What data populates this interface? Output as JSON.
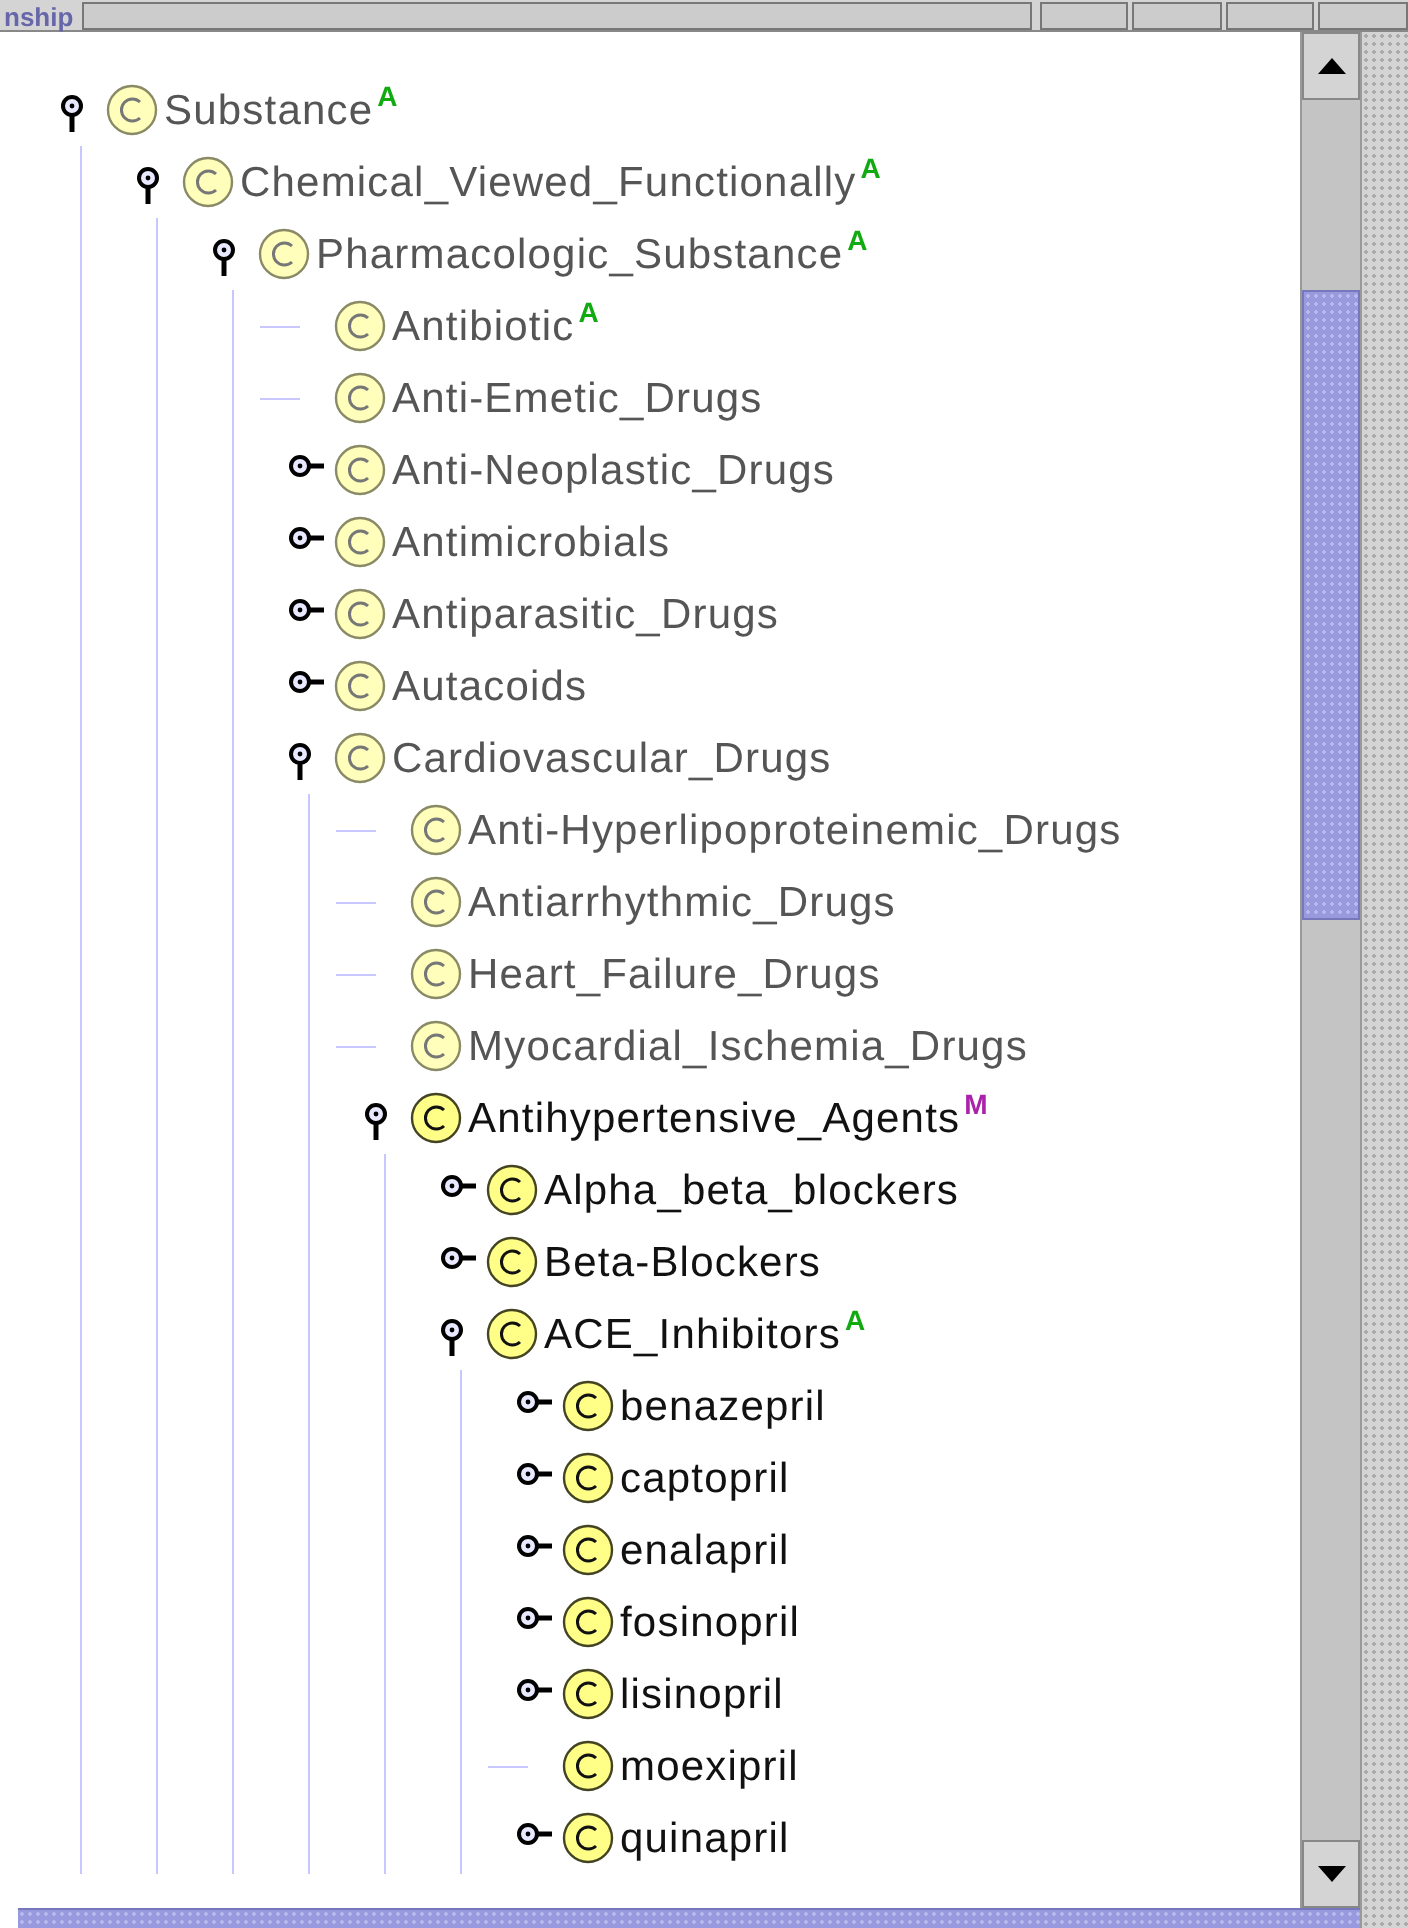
{
  "header": {
    "label": "nship"
  },
  "tree": [
    {
      "name": "Substance",
      "expanded": true,
      "greyed": true,
      "badge": "A",
      "children": [
        {
          "name": "Chemical_Viewed_Functionally",
          "expanded": true,
          "greyed": true,
          "badge": "A",
          "children": [
            {
              "name": "Pharmacologic_Substance",
              "expanded": true,
              "greyed": true,
              "badge": "A",
              "children": [
                {
                  "name": "Antibiotic",
                  "greyed": true,
                  "badge": "A"
                },
                {
                  "name": "Anti-Emetic_Drugs",
                  "greyed": true
                },
                {
                  "name": "Anti-Neoplastic_Drugs",
                  "expanded": false,
                  "greyed": true
                },
                {
                  "name": "Antimicrobials",
                  "expanded": false,
                  "greyed": true
                },
                {
                  "name": "Antiparasitic_Drugs",
                  "expanded": false,
                  "greyed": true
                },
                {
                  "name": "Autacoids",
                  "expanded": false,
                  "greyed": true
                },
                {
                  "name": "Cardiovascular_Drugs",
                  "expanded": true,
                  "greyed": true,
                  "children": [
                    {
                      "name": "Anti-Hyperlipoproteinemic_Drugs",
                      "greyed": true
                    },
                    {
                      "name": "Antiarrhythmic_Drugs",
                      "greyed": true
                    },
                    {
                      "name": "Heart_Failure_Drugs",
                      "greyed": true
                    },
                    {
                      "name": "Myocardial_Ischemia_Drugs",
                      "greyed": true
                    },
                    {
                      "name": "Antihypertensive_Agents",
                      "expanded": true,
                      "greyed": false,
                      "badge": "M",
                      "children": [
                        {
                          "name": "Alpha_beta_blockers",
                          "expanded": false,
                          "greyed": false
                        },
                        {
                          "name": "Beta-Blockers",
                          "expanded": false,
                          "greyed": false
                        },
                        {
                          "name": "ACE_Inhibitors",
                          "expanded": true,
                          "greyed": false,
                          "badge": "A",
                          "children": [
                            {
                              "name": "benazepril",
                              "expanded": false,
                              "greyed": false
                            },
                            {
                              "name": "captopril",
                              "expanded": false,
                              "greyed": false
                            },
                            {
                              "name": "enalapril",
                              "expanded": false,
                              "greyed": false
                            },
                            {
                              "name": "fosinopril",
                              "expanded": false,
                              "greyed": false
                            },
                            {
                              "name": "lisinopril",
                              "expanded": false,
                              "greyed": false
                            },
                            {
                              "name": "moexipril",
                              "greyed": false
                            },
                            {
                              "name": "quinapril",
                              "expanded": false,
                              "greyed": false
                            }
                          ]
                        }
                      ]
                    }
                  ]
                }
              ]
            }
          ]
        }
      ]
    }
  ]
}
